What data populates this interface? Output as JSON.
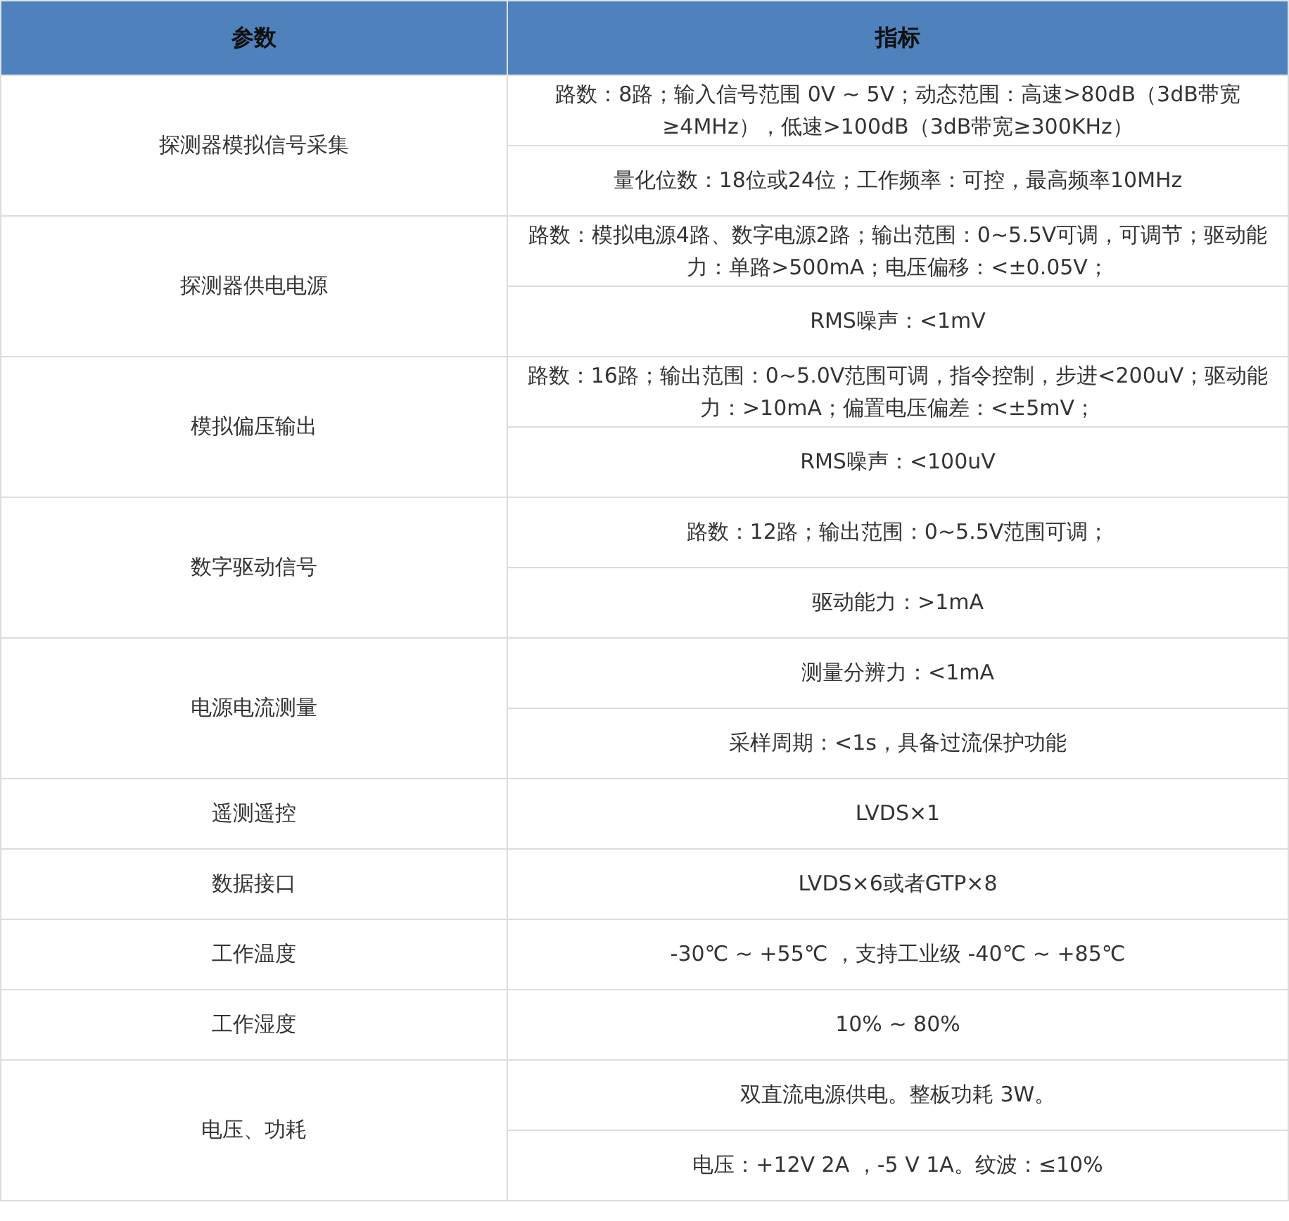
{
  "table": {
    "columns": [
      "参数",
      "指标"
    ],
    "rows": [
      {
        "parameter": "探测器模拟信号采集",
        "specs": [
          "路数：8路；输入信号范围 0V ~ 5V；动态范围：高速>80dB（3dB带宽≥4MHz），低速>100dB（3dB带宽≥300KHz）",
          "量化位数：18位或24位；工作频率：可控，最高频率10MHz"
        ]
      },
      {
        "parameter": "探测器供电电源",
        "specs": [
          "路数：模拟电源4路、数字电源2路；输出范围：0~5.5V可调，可调节；驱动能力：单路>500mA；电压偏移：<±0.05V；",
          "RMS噪声：<1mV"
        ]
      },
      {
        "parameter": "模拟偏压输出",
        "specs": [
          "路数：16路；输出范围：0~5.0V范围可调，指令控制，步进<200uV；驱动能力：>10mA；偏置电压偏差：<±5mV；",
          "RMS噪声：<100uV"
        ]
      },
      {
        "parameter": "数字驱动信号",
        "specs": [
          "路数：12路；输出范围：0~5.5V范围可调；",
          "驱动能力：>1mA"
        ]
      },
      {
        "parameter": "电源电流测量",
        "specs": [
          "测量分辨力：<1mA",
          "采样周期：<1s，具备过流保护功能"
        ]
      },
      {
        "parameter": "遥测遥控",
        "specs": [
          "LVDS×1"
        ]
      },
      {
        "parameter": "数据接口",
        "specs": [
          "LVDS×6或者GTP×8"
        ]
      },
      {
        "parameter": "工作温度",
        "specs": [
          "-30℃ ~  +55℃ ，支持工业级 -40℃ ~  +85℃"
        ]
      },
      {
        "parameter": "工作湿度",
        "specs": [
          "10% ~ 80%"
        ]
      },
      {
        "parameter": "电压、功耗",
        "specs": [
          "双直流电源供电。整板功耗 3W。",
          "电压：+12V 2A ，-5 V 1A。纹波：≤10%"
        ]
      }
    ]
  }
}
